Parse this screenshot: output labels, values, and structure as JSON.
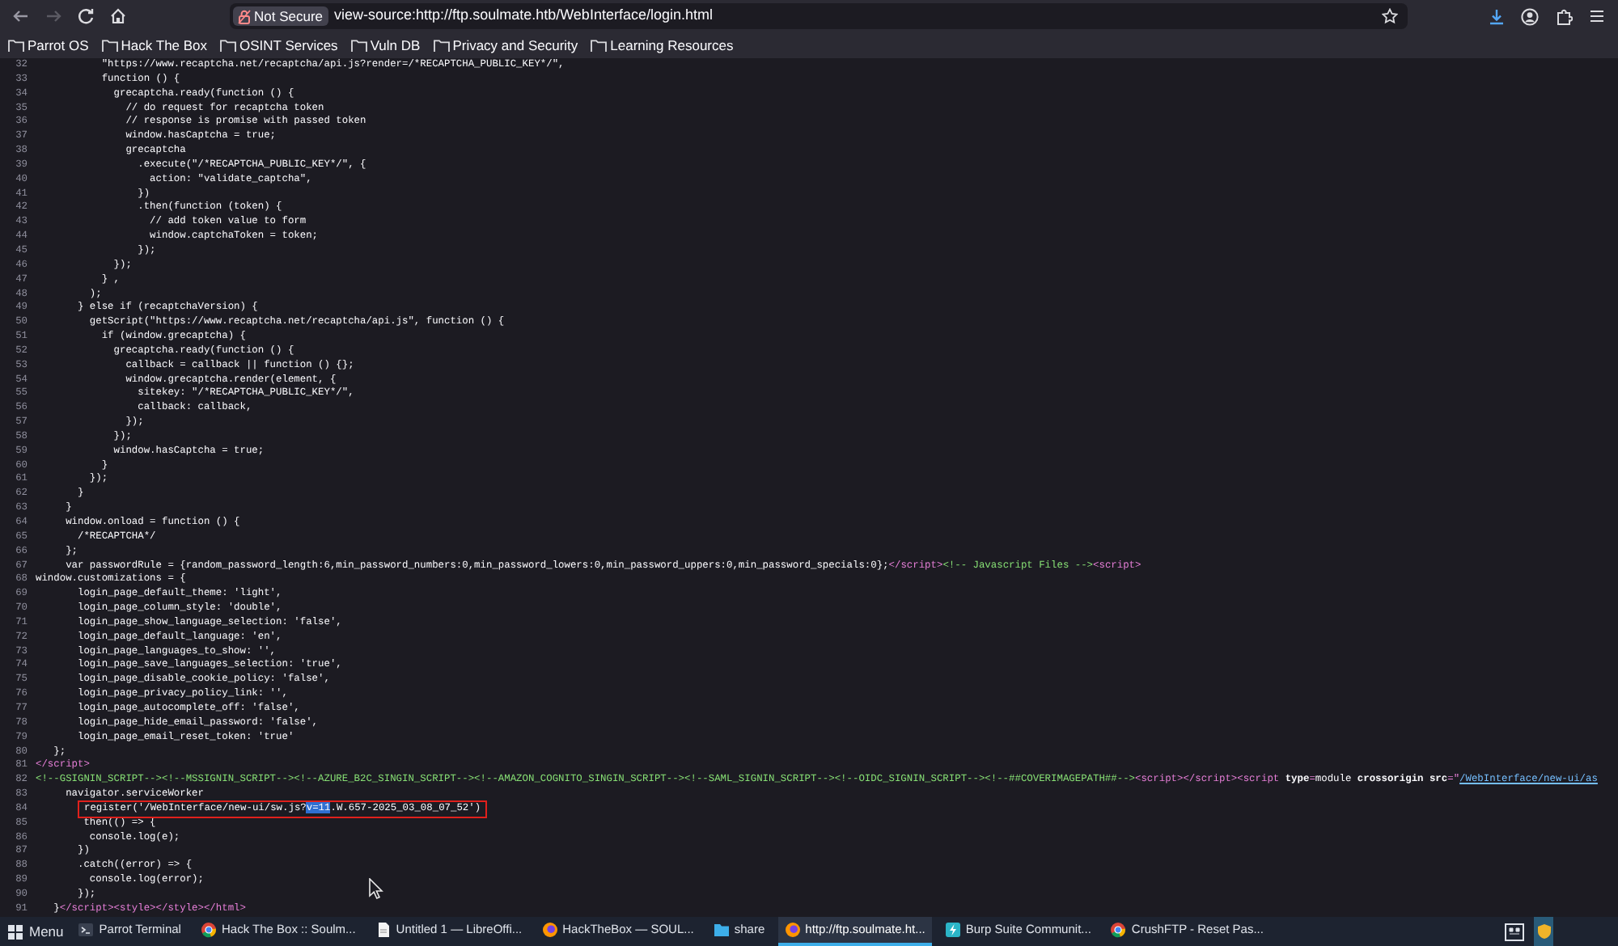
{
  "browser": {
    "security_label": "Not Secure",
    "url": "view-source:http://ftp.soulmate.htb/WebInterface/login.html"
  },
  "bookmarks": [
    "Parrot OS",
    "Hack The Box",
    "OSINT Services",
    "Vuln DB",
    "Privacy and Security",
    "Learning Resources"
  ],
  "source_lines": [
    {
      "n": "32",
      "parts": [
        {
          "kind": "code",
          "text": "           \"https://www.recaptcha.net/recaptcha/api.js?render=/*RECAPTCHA_PUBLIC_KEY*/\","
        }
      ]
    },
    {
      "n": "33",
      "parts": [
        {
          "kind": "code",
          "text": "           function () {"
        }
      ]
    },
    {
      "n": "34",
      "parts": [
        {
          "kind": "code",
          "text": "             grecaptcha.ready(function () {"
        }
      ]
    },
    {
      "n": "35",
      "parts": [
        {
          "kind": "code",
          "text": "               // do request for recaptcha token"
        }
      ]
    },
    {
      "n": "36",
      "parts": [
        {
          "kind": "code",
          "text": "               // response is promise with passed token"
        }
      ]
    },
    {
      "n": "37",
      "parts": [
        {
          "kind": "code",
          "text": "               window.hasCaptcha = true;"
        }
      ]
    },
    {
      "n": "38",
      "parts": [
        {
          "kind": "code",
          "text": "               grecaptcha"
        }
      ]
    },
    {
      "n": "39",
      "parts": [
        {
          "kind": "code",
          "text": "                 .execute(\"/*RECAPTCHA_PUBLIC_KEY*/\", {"
        }
      ]
    },
    {
      "n": "40",
      "parts": [
        {
          "kind": "code",
          "text": "                   action: \"validate_captcha\","
        }
      ]
    },
    {
      "n": "41",
      "parts": [
        {
          "kind": "code",
          "text": "                 })"
        }
      ]
    },
    {
      "n": "42",
      "parts": [
        {
          "kind": "code",
          "text": "                 .then(function (token) {"
        }
      ]
    },
    {
      "n": "43",
      "parts": [
        {
          "kind": "code",
          "text": "                   // add token value to form"
        }
      ]
    },
    {
      "n": "44",
      "parts": [
        {
          "kind": "code",
          "text": "                   window.captchaToken = token;"
        }
      ]
    },
    {
      "n": "45",
      "parts": [
        {
          "kind": "code",
          "text": "                 });"
        }
      ]
    },
    {
      "n": "46",
      "parts": [
        {
          "kind": "code",
          "text": "             });"
        }
      ]
    },
    {
      "n": "47",
      "parts": [
        {
          "kind": "code",
          "text": "           } ,"
        }
      ]
    },
    {
      "n": "48",
      "parts": [
        {
          "kind": "code",
          "text": "         );"
        }
      ]
    },
    {
      "n": "49",
      "parts": [
        {
          "kind": "code",
          "text": "       } else if (recaptchaVersion) {"
        }
      ]
    },
    {
      "n": "50",
      "parts": [
        {
          "kind": "code",
          "text": "         getScript(\"https://www.recaptcha.net/recaptcha/api.js\", function () {"
        }
      ]
    },
    {
      "n": "51",
      "parts": [
        {
          "kind": "code",
          "text": "           if (window.grecaptcha) {"
        }
      ]
    },
    {
      "n": "52",
      "parts": [
        {
          "kind": "code",
          "text": "             grecaptcha.ready(function () {"
        }
      ]
    },
    {
      "n": "53",
      "parts": [
        {
          "kind": "code",
          "text": "               callback = callback || function () {};"
        }
      ]
    },
    {
      "n": "54",
      "parts": [
        {
          "kind": "code",
          "text": "               window.grecaptcha.render(element, {"
        }
      ]
    },
    {
      "n": "55",
      "parts": [
        {
          "kind": "code",
          "text": "                 sitekey: \"/*RECAPTCHA_PUBLIC_KEY*/\","
        }
      ]
    },
    {
      "n": "56",
      "parts": [
        {
          "kind": "code",
          "text": "                 callback: callback,"
        }
      ]
    },
    {
      "n": "57",
      "parts": [
        {
          "kind": "code",
          "text": "               });"
        }
      ]
    },
    {
      "n": "58",
      "parts": [
        {
          "kind": "code",
          "text": "             });"
        }
      ]
    },
    {
      "n": "59",
      "parts": [
        {
          "kind": "code",
          "text": "             window.hasCaptcha = true;"
        }
      ]
    },
    {
      "n": "60",
      "parts": [
        {
          "kind": "code",
          "text": "           }"
        }
      ]
    },
    {
      "n": "61",
      "parts": [
        {
          "kind": "code",
          "text": "         });"
        }
      ]
    },
    {
      "n": "62",
      "parts": [
        {
          "kind": "code",
          "text": "       }"
        }
      ]
    },
    {
      "n": "63",
      "parts": [
        {
          "kind": "code",
          "text": "     }"
        }
      ]
    },
    {
      "n": "64",
      "parts": [
        {
          "kind": "code",
          "text": "     window.onload = function () {"
        }
      ]
    },
    {
      "n": "65",
      "parts": [
        {
          "kind": "code",
          "text": "       /*RECAPTCHA*/"
        }
      ]
    },
    {
      "n": "66",
      "parts": [
        {
          "kind": "code",
          "text": "     };"
        }
      ]
    },
    {
      "n": "67",
      "parts": [
        {
          "kind": "code",
          "text": "     var passwordRule = {random_password_length:6,min_password_numbers:0,min_password_lowers:0,min_password_uppers:0,min_password_specials:0};"
        },
        {
          "kind": "tag",
          "text": "</script>"
        },
        {
          "kind": "comment",
          "text": "<!-- Javascript Files -->"
        },
        {
          "kind": "tag",
          "text": "<script>"
        }
      ]
    },
    {
      "n": "68",
      "parts": [
        {
          "kind": "code",
          "text": "window.customizations = {"
        }
      ]
    },
    {
      "n": "69",
      "parts": [
        {
          "kind": "code",
          "text": "       login_page_default_theme: 'light',"
        }
      ]
    },
    {
      "n": "70",
      "parts": [
        {
          "kind": "code",
          "text": "       login_page_column_style: 'double',"
        }
      ]
    },
    {
      "n": "71",
      "parts": [
        {
          "kind": "code",
          "text": "       login_page_show_language_selection: 'false',"
        }
      ]
    },
    {
      "n": "72",
      "parts": [
        {
          "kind": "code",
          "text": "       login_page_default_language: 'en',"
        }
      ]
    },
    {
      "n": "73",
      "parts": [
        {
          "kind": "code",
          "text": "       login_page_languages_to_show: '',"
        }
      ]
    },
    {
      "n": "74",
      "parts": [
        {
          "kind": "code",
          "text": "       login_page_save_languages_selection: 'true',"
        }
      ]
    },
    {
      "n": "75",
      "parts": [
        {
          "kind": "code",
          "text": "       login_page_disable_cookie_policy: 'false',"
        }
      ]
    },
    {
      "n": "76",
      "parts": [
        {
          "kind": "code",
          "text": "       login_page_privacy_policy_link: '',"
        }
      ]
    },
    {
      "n": "77",
      "parts": [
        {
          "kind": "code",
          "text": "       login_page_autocomplete_off: 'false',"
        }
      ]
    },
    {
      "n": "78",
      "parts": [
        {
          "kind": "code",
          "text": "       login_page_hide_email_password: 'false',"
        }
      ]
    },
    {
      "n": "79",
      "parts": [
        {
          "kind": "code",
          "text": "       login_page_email_reset_token: 'true'"
        }
      ]
    },
    {
      "n": "80",
      "parts": [
        {
          "kind": "code",
          "text": "   };"
        }
      ]
    },
    {
      "n": "81",
      "parts": [
        {
          "kind": "tag",
          "text": "</script>"
        }
      ]
    },
    {
      "n": "82",
      "parts": [
        {
          "kind": "comment",
          "text": "<!--GSIGNIN_SCRIPT--><!--MSSIGNIN_SCRIPT--><!--AZURE_B2C_SINGIN_SCRIPT--><!--AMAZON_COGNITO_SINGIN_SCRIPT--><!--SAML_SIGNIN_SCRIPT--><!--OIDC_SIGNIN_SCRIPT--><!--##COVERIMAGEPATH##-->"
        },
        {
          "kind": "tag",
          "text": "<script></script><script "
        },
        {
          "kind": "attr",
          "text": "type"
        },
        {
          "kind": "tag",
          "text": "="
        },
        {
          "kind": "code",
          "text": "module "
        },
        {
          "kind": "attr",
          "text": "crossorigin src"
        },
        {
          "kind": "tag",
          "text": "=\""
        },
        {
          "kind": "value",
          "text": "/WebInterface/new-ui/as"
        }
      ]
    },
    {
      "n": "83",
      "parts": [
        {
          "kind": "code",
          "text": "     navigator.serviceWorker"
        }
      ]
    },
    {
      "n": "84",
      "boxed": true,
      "parts": [
        {
          "kind": "code",
          "text": "register('/WebInterface/new-ui/sw.js?"
        },
        {
          "kind": "selected",
          "text": "v=11"
        },
        {
          "kind": "code",
          "text": ".W.657-2025_03_08_07_52')"
        }
      ]
    },
    {
      "n": "85",
      "parts": [
        {
          "kind": "code",
          "text": "        then(() => {"
        }
      ]
    },
    {
      "n": "86",
      "parts": [
        {
          "kind": "code",
          "text": "         console.log(e);"
        }
      ]
    },
    {
      "n": "87",
      "parts": [
        {
          "kind": "code",
          "text": "       })"
        }
      ]
    },
    {
      "n": "88",
      "parts": [
        {
          "kind": "code",
          "text": "       .catch((error) => {"
        }
      ]
    },
    {
      "n": "89",
      "parts": [
        {
          "kind": "code",
          "text": "         console.log(error);"
        }
      ]
    },
    {
      "n": "90",
      "parts": [
        {
          "kind": "code",
          "text": "       });"
        }
      ]
    },
    {
      "n": "91",
      "parts": [
        {
          "kind": "code",
          "text": "   }"
        },
        {
          "kind": "tag",
          "text": "</script><style></style></html>"
        }
      ]
    }
  ],
  "taskbar": {
    "menu_label": "Menu",
    "items": [
      {
        "kind": "terminal",
        "label": "Parrot Terminal",
        "selected": false
      },
      {
        "kind": "chrome",
        "label": "Hack The Box :: Soulm...",
        "selected": false
      },
      {
        "kind": "document",
        "label": "Untitled 1 — LibreOffi...",
        "selected": false
      },
      {
        "kind": "firefox",
        "label": "HackTheBox — SOUL...",
        "selected": false
      },
      {
        "kind": "folder",
        "label": "share",
        "selected": false
      },
      {
        "kind": "firefox",
        "label": "http://ftp.soulmate.ht...",
        "selected": true
      },
      {
        "kind": "burp",
        "label": "Burp Suite Communit...",
        "selected": false
      },
      {
        "kind": "chrome",
        "label": "CrushFTP - Reset Pas...",
        "selected": false
      }
    ]
  }
}
